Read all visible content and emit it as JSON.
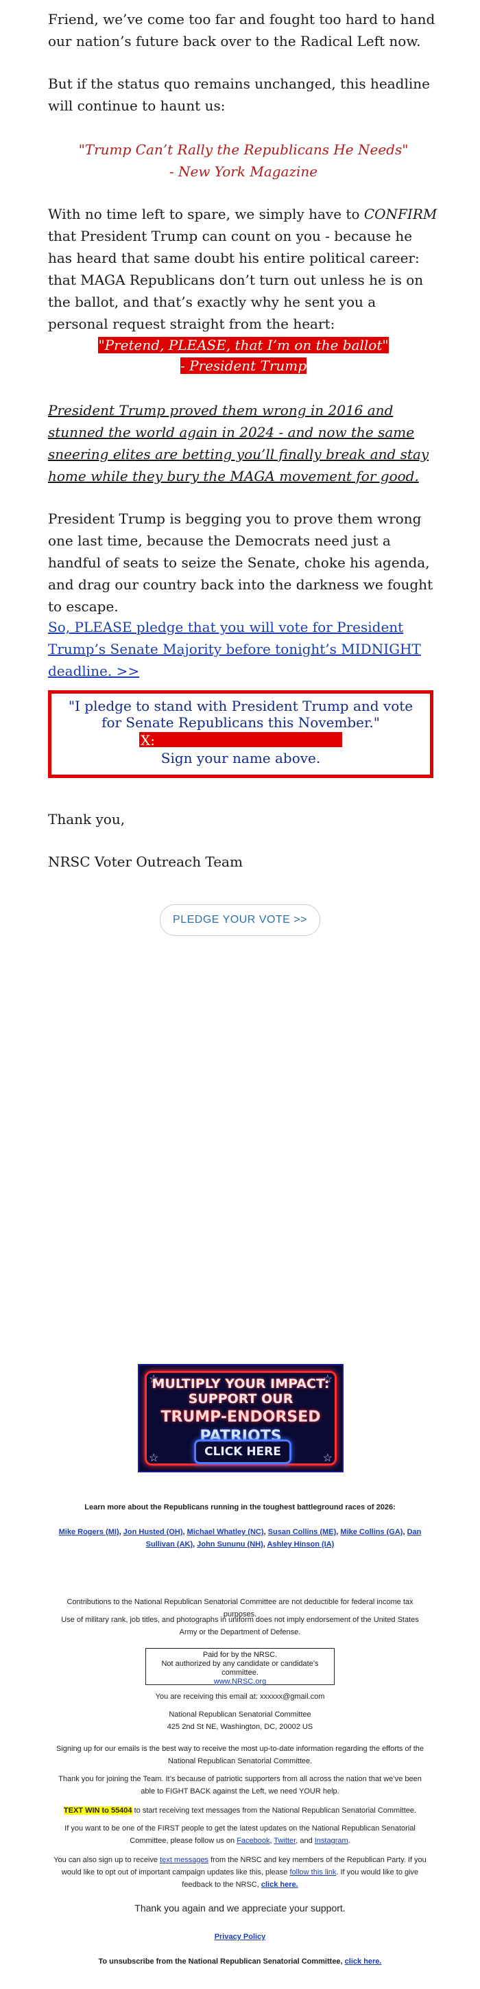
{
  "body": {
    "p1": "Friend, we’ve come too far and fought too hard to hand our nation’s future back over to the Radical Left now.",
    "p2": "But if the status quo remains unchanged, this headline will continue to haunt us:",
    "quote1_line1": "\"Trump Can’t Rally the Republicans He Needs\"",
    "quote1_line2": "- New York Magazine",
    "p3_a": "With no time left to spare, we simply have to ",
    "p3_em": "CONFIRM",
    "p3_b": " that President Trump can count on you - because he has heard that same doubt his entire political career: that MAGA Republicans don’t turn out unless he is on the ballot, and that’s exactly why he sent you a personal request straight from the heart:",
    "quote2_line1": "\"Pretend, PLEASE, that I’m on the ballot\"",
    "quote2_line2": "- President Trump",
    "p4": "President Trump proved them wrong in 2016 and stunned the world again in 2024 - and now the same sneering elites are betting you’ll finally break and stay home while they bury the MAGA movement for good.",
    "p5": "President Trump is begging you to prove them wrong one last time, because the Democrats need just a handful of seats to seize the Senate, choke his agenda, and drag our country back into the darkness we fought to escape.",
    "link": "So, PLEASE pledge that you will vote for President Trump’s Senate Majority before tonight’s MIDNIGHT deadline. >>",
    "pledge_text": "\"I pledge to stand with President Trump and vote for Senate Republicans this November.\"",
    "sig_label": "X:",
    "sig_instruction": "Sign your name above.",
    "thanks": "Thank you,",
    "signoff": "NRSC Voter Outreach Team",
    "button": "PLEDGE YOUR VOTE >>"
  },
  "banner": {
    "line1": "MULTIPLY YOUR IMPACT:",
    "line2": "SUPPORT OUR",
    "line3a": "TRUMP-ENDORSED",
    "line3b": "PATRIOTS",
    "cta": "CLICK HERE"
  },
  "footer": {
    "learn_more": "Learn more about the Republicans running in the toughest battleground races of 2026:",
    "candidates": [
      "Mike Rogers (MI)",
      "Jon Husted (OH)",
      "Michael Whatley (NC)",
      "Susan Collins (ME)",
      "Mike Collins (GA)",
      "Dan Sullivan (AK)",
      "John Sununu (NH)",
      "Ashley Hinson (IA)"
    ],
    "not_deductible": "Contributions to the National Republican Senatorial Committee are not deductible for federal income tax purposes.",
    "military": "Use of military rank, job titles, and photographs in uniform does not imply endorsement of the United States Army or the Department of Defense.",
    "paid_line1": "Paid for by the NRSC.",
    "paid_line2": "Not authorized by any candidate or candidate’s committee.",
    "paid_line3": "www.NRSC.org",
    "receiving": "You are receiving this email at: xxxxxx@gmail.com",
    "org_name": "National Republican Senatorial Committee",
    "org_address": "425 2nd St NE, Washington, DC, 20002 US",
    "signing_up": "Signing up for our emails is the best way to receive the most up-to-date information regarding the efforts of the National Republican Senatorial Committee.",
    "thank_joining": "Thank you for joining the Team. It’s because of patriotic supporters from all across the nation that we’ve been able to FIGHT BACK against the Left, we need YOUR help.",
    "text_win_hl": "TEXT WIN to 55404",
    "text_win_rest": " to start receiving text messages from the National Republican Senatorial Committee.",
    "first_people_a": "If you want to be one of the FIRST people to get the latest updates on the National Republican Senatorial Committee, please follow us on ",
    "facebook": "Facebook",
    "twitter": "Twitter",
    "and_word": ", and ",
    "instagram": "Instagram",
    "sms_a": "You can also sign up to receive ",
    "sms_link": "text messages",
    "sms_b": " from the NRSC and key members of the Republican Party. If you would like to opt out of important campaign updates like this, please ",
    "follow_link": "follow this link",
    "sms_c": ". If you would like to give feedback to the NRSC, ",
    "click_here": "click here.",
    "thank_you_again": "Thank you again and we appreciate your support.",
    "privacy": "Privacy Policy",
    "unsub_a": "To unsubscribe from the National Republican Senatorial Committee, ",
    "unsub_link": "click here."
  }
}
